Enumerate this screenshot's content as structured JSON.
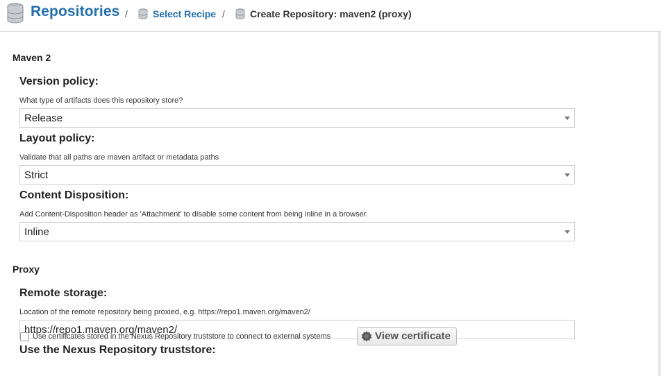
{
  "breadcrumb": {
    "root": "Repositories",
    "separator": "/",
    "link": "Select Recipe",
    "current": "Create Repository: maven2 (proxy)"
  },
  "maven": {
    "section_title": "Maven 2",
    "version_policy": {
      "label": "Version policy:",
      "help": "What type of artifacts does this repository store?",
      "value": "Release"
    },
    "layout_policy": {
      "label": "Layout policy:",
      "help": "Validate that all paths are maven artifact or metadata paths",
      "value": "Strict"
    },
    "content_disposition": {
      "label": "Content Disposition:",
      "help": "Add Content-Disposition header as 'Attachment' to disable some content from being inline in a browser.",
      "value": "Inline"
    }
  },
  "proxy": {
    "section_title": "Proxy",
    "remote_storage": {
      "label": "Remote storage:",
      "help": "Location of the remote repository being proxied, e.g. https://repo1.maven.org/maven2/",
      "value": "https://repo1.maven.org/maven2/"
    },
    "truststore": {
      "label": "Use the Nexus Repository truststore:",
      "checkbox_label": "Use certificates stored in the Nexus Repository truststore to connect to external systems",
      "checked": false,
      "button_label": "View certificate"
    }
  },
  "colors": {
    "link": "#1f6fb5",
    "border": "#cfcfcf"
  },
  "icons": [
    "database-icon",
    "database-icon",
    "database-icon",
    "certificate-icon",
    "chevron-down-icon"
  ]
}
